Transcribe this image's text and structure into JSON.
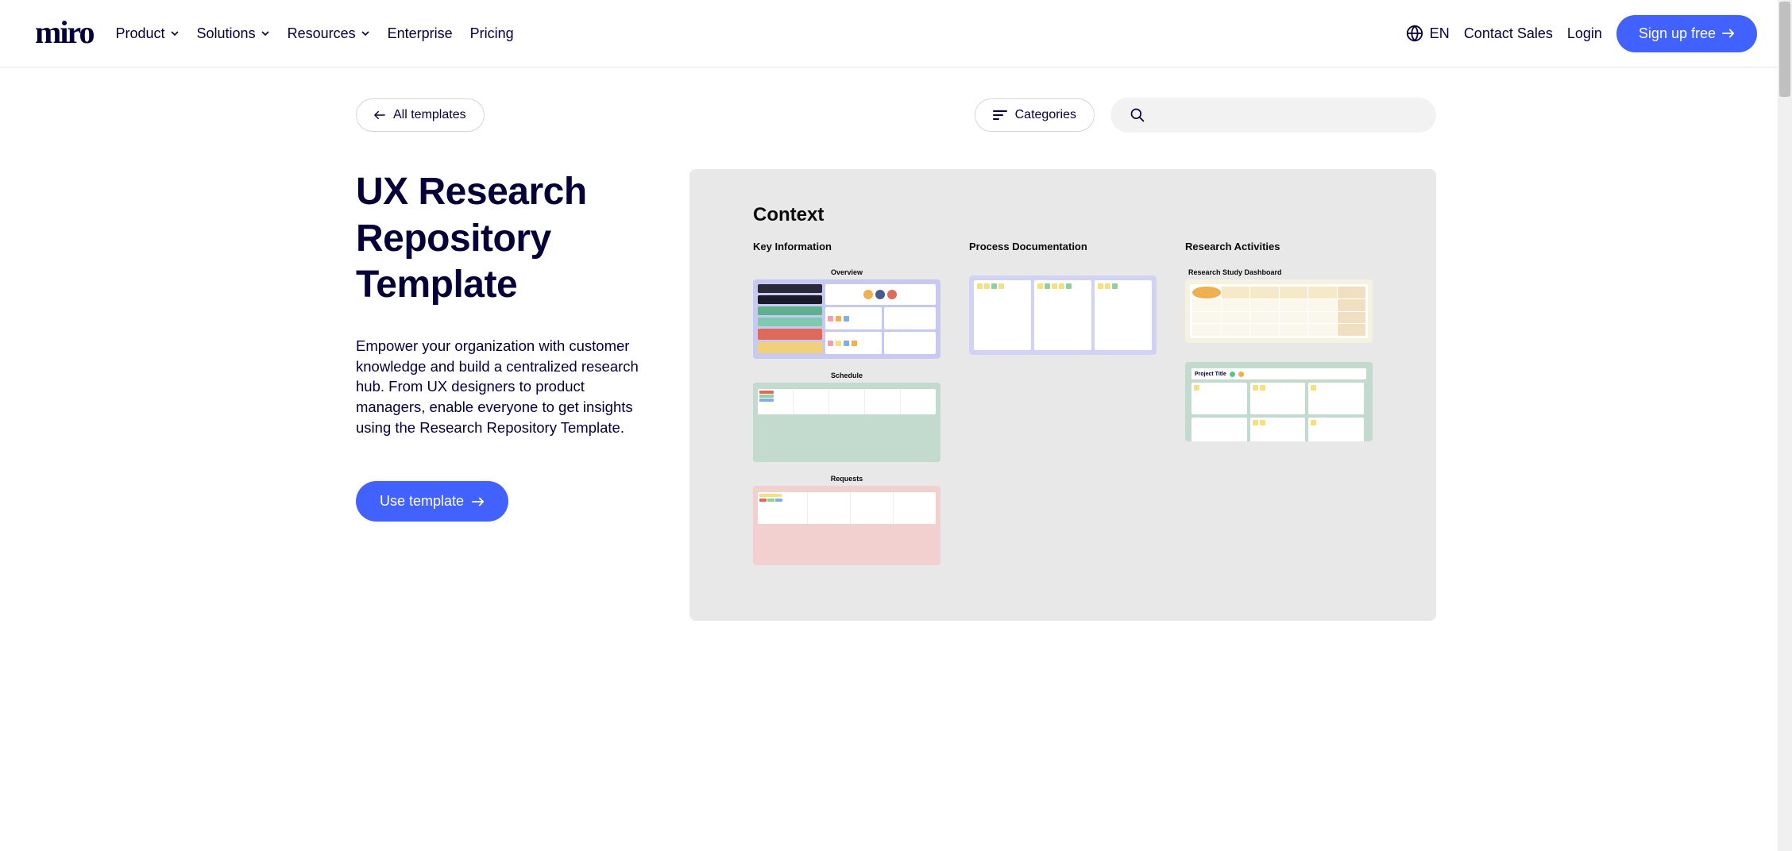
{
  "brand": "miro",
  "nav": {
    "items": [
      {
        "label": "Product",
        "has_chevron": true
      },
      {
        "label": "Solutions",
        "has_chevron": true
      },
      {
        "label": "Resources",
        "has_chevron": true
      },
      {
        "label": "Enterprise",
        "has_chevron": false
      },
      {
        "label": "Pricing",
        "has_chevron": false
      }
    ]
  },
  "header_right": {
    "language": "EN",
    "contact": "Contact Sales",
    "login": "Login",
    "signup": "Sign up free"
  },
  "controls": {
    "back": "All templates",
    "categories": "Categories",
    "search_placeholder": ""
  },
  "page": {
    "title": "UX Research Repository Template",
    "description": "Empower your organization with customer knowledge and build a centralized research hub. From UX designers to product managers, enable everyone to get insights using the Research Repository Template.",
    "cta": "Use template"
  },
  "preview": {
    "heading": "Context",
    "columns": [
      {
        "title": "Key Information",
        "sections": [
          {
            "label": "Overview"
          },
          {
            "label": "Schedule"
          },
          {
            "label": "Requests"
          }
        ]
      },
      {
        "title": "Process Documentation",
        "sections": []
      },
      {
        "title": "Research Activities",
        "sections": [
          {
            "label": "Research Study Dashboard"
          },
          {
            "label": "Project Title"
          }
        ]
      }
    ]
  },
  "colors": {
    "brand_blue": "#4262ff",
    "text_navy": "#050038",
    "panel_grey": "#e8e8e8"
  }
}
